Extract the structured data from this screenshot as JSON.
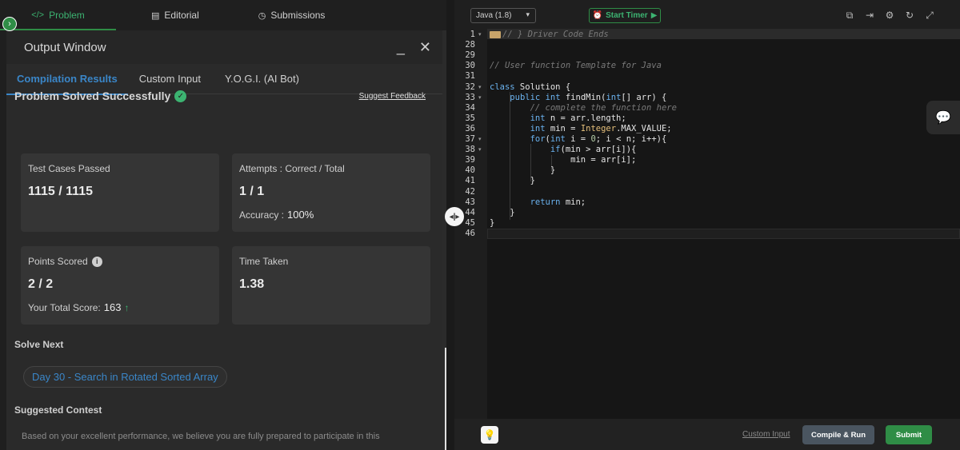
{
  "top_tabs": [
    {
      "icon": "</>",
      "label": "Problem"
    },
    {
      "icon": "▤",
      "label": "Editorial"
    },
    {
      "icon": "◷",
      "label": "Submissions"
    }
  ],
  "output": {
    "title": "Output Window",
    "tabs": [
      "Compilation Results",
      "Custom Input",
      "Y.O.G.I. (AI Bot)"
    ],
    "status": "Problem Solved Successfully",
    "feedback_link": "Suggest Feedback",
    "cards": {
      "test_cases": {
        "label": "Test Cases Passed",
        "value": "1115 / 1115"
      },
      "attempts": {
        "label": "Attempts : Correct / Total",
        "value": "1 / 1",
        "sub_label": "Accuracy :",
        "sub_value": "100%"
      },
      "points": {
        "label": "Points Scored",
        "value": "2 / 2",
        "sub_label": "Your Total Score:",
        "sub_value": "163"
      },
      "time": {
        "label": "Time Taken",
        "value": "1.38"
      }
    },
    "solve_next_title": "Solve Next",
    "solve_next_item": "Day 30 - Search in Rotated Sorted Array",
    "suggested_contest_title": "Suggested Contest",
    "suggested_contest_text": "Based on your excellent performance, we believe you are fully prepared to participate in this"
  },
  "editor": {
    "language": "Java (1.8)",
    "timer_label": "Start Timer",
    "lines": [
      {
        "n": "1",
        "html": "<span class=\"fold-mark\"></span><span class=\"cm\">// } Driver Code Ends</span>"
      },
      {
        "n": "28",
        "html": ""
      },
      {
        "n": "29",
        "html": ""
      },
      {
        "n": "30",
        "html": "<span class=\"cm\">// User function Template for Java</span>"
      },
      {
        "n": "31",
        "html": ""
      },
      {
        "n": "32",
        "html": "<span class=\"kw\">class</span> Solution {"
      },
      {
        "n": "33",
        "html": "    <span class=\"kw\">public</span> <span class=\"kw\">int</span> findMin(<span class=\"kw\">int</span>[] arr) {"
      },
      {
        "n": "34",
        "html": "        <span class=\"cm\">// complete the function here</span>"
      },
      {
        "n": "35",
        "html": "        <span class=\"kw\">int</span> n = arr.length;"
      },
      {
        "n": "36",
        "html": "        <span class=\"kw\">int</span> min = <span class=\"cls\">Integer</span>.MAX_VALUE;"
      },
      {
        "n": "37",
        "html": "        <span class=\"kw\">for</span>(<span class=\"kw\">int</span> i = <span class=\"num\">0</span>; i &lt; n; i++){"
      },
      {
        "n": "38",
        "html": "            <span class=\"kw\">if</span>(min &gt; arr[i]){"
      },
      {
        "n": "39",
        "html": "                min = arr[i];"
      },
      {
        "n": "40",
        "html": "            }"
      },
      {
        "n": "41",
        "html": "        }"
      },
      {
        "n": "42",
        "html": ""
      },
      {
        "n": "43",
        "html": "        <span class=\"kw\">return</span> min;"
      },
      {
        "n": "44",
        "html": "    }"
      },
      {
        "n": "45",
        "html": "}"
      },
      {
        "n": "46",
        "html": ""
      }
    ],
    "custom_input_label": "Custom Input",
    "compile_label": "Compile & Run",
    "submit_label": "Submit"
  }
}
